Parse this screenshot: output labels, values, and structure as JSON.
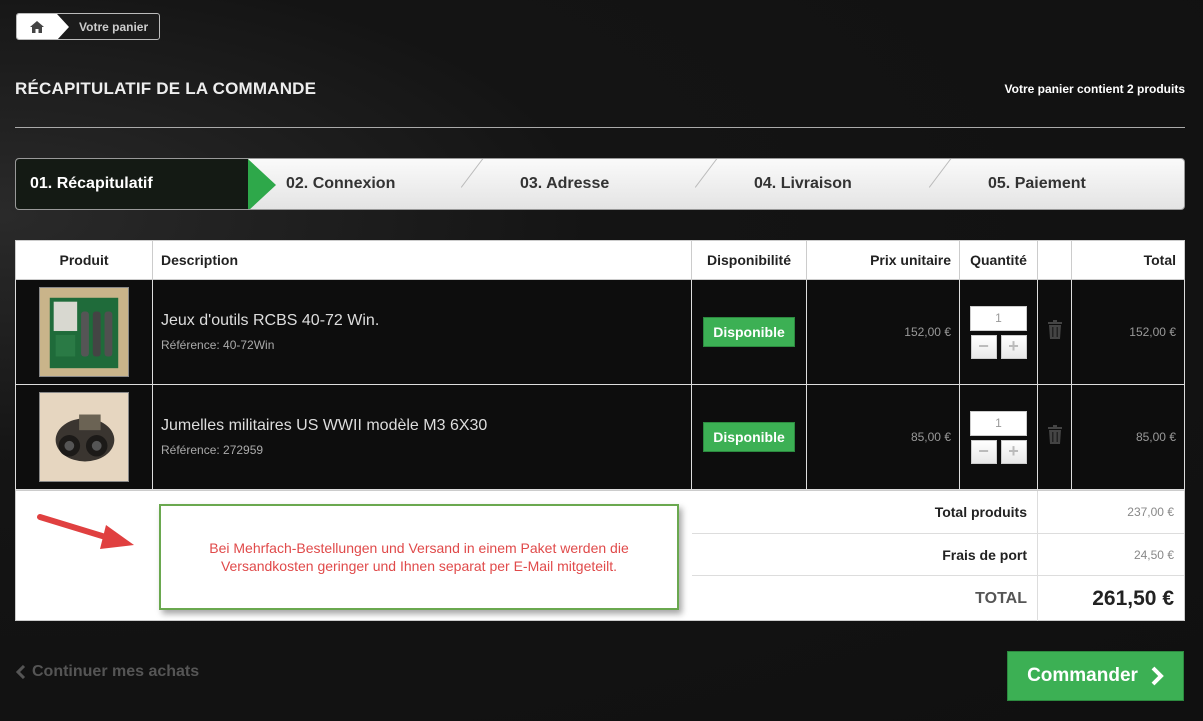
{
  "breadcrumb": {
    "current": "Votre panier"
  },
  "header": {
    "title": "RÉCAPITULATIF DE LA COMMANDE",
    "cart_count": "Votre panier contient 2 produits"
  },
  "steps": [
    "01. Récapitulatif",
    "02. Connexion",
    "03. Adresse",
    "04. Livraison",
    "05. Paiement"
  ],
  "table": {
    "headers": {
      "product": "Produit",
      "description": "Description",
      "availability": "Disponibilité",
      "unit_price": "Prix unitaire",
      "quantity": "Quantité",
      "total": "Total"
    },
    "rows": [
      {
        "name": "Jeux d'outils RCBS 40-72 Win.",
        "reference": "Référence: 40-72Win",
        "availability": "Disponible",
        "unit_price": "152,00 €",
        "quantity": "1",
        "total": "152,00 €"
      },
      {
        "name": "Jumelles militaires US WWII modèle M3 6X30",
        "reference": "Référence: 272959",
        "availability": "Disponible",
        "unit_price": "85,00 €",
        "quantity": "1",
        "total": "85,00 €"
      }
    ]
  },
  "summary": {
    "products_label": "Total produits",
    "products_value": "237,00 €",
    "shipping_label": "Frais de port",
    "shipping_value": "24,50 €",
    "total_label": "TOTAL",
    "total_value": "261,50 €"
  },
  "notice": "Bei Mehrfach-Bestellungen und Versand in einem Paket werden die Versandkosten geringer und Ihnen separat per E-Mail mitgeteilt.",
  "footer": {
    "continue": "Continuer mes achats",
    "order": "Commander"
  },
  "colors": {
    "accent": "#3cb054",
    "notice_text": "#e04a4a",
    "notice_border": "#6aa84f"
  }
}
